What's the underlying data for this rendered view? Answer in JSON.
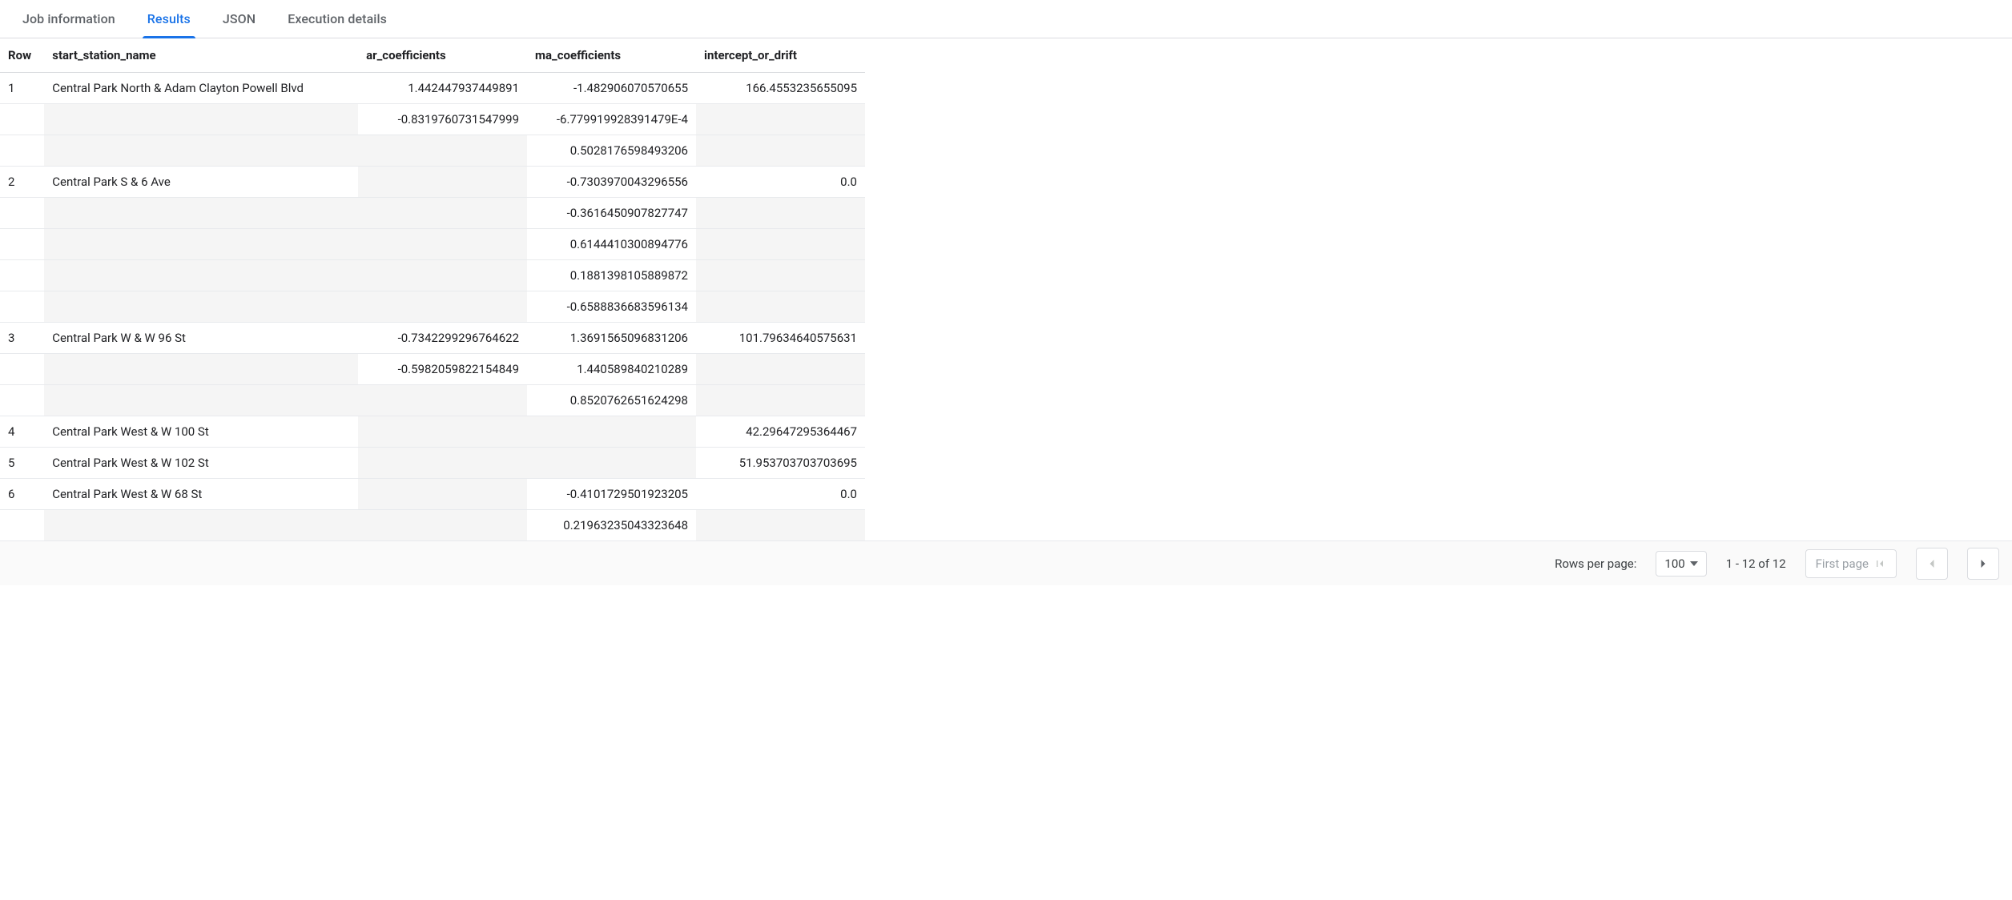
{
  "tabs": {
    "job_information": "Job information",
    "results": "Results",
    "json": "JSON",
    "execution_details": "Execution details"
  },
  "columns": {
    "row": "Row",
    "start_station_name": "start_station_name",
    "ar_coefficients": "ar_coefficients",
    "ma_coefficients": "ma_coefficients",
    "intercept_or_drift": "intercept_or_drift"
  },
  "rows": [
    {
      "row": "1",
      "name": "Central Park North & Adam Clayton Powell Blvd",
      "ar": [
        "1.442447937449891",
        "-0.8319760731547999",
        ""
      ],
      "ma": [
        "-1.482906070570655",
        "-6.779919928391479E-4",
        "0.5028176598493206"
      ],
      "intercept": "166.4553235655095"
    },
    {
      "row": "2",
      "name": "Central Park S & 6 Ave",
      "ar": [
        "",
        "",
        "",
        "",
        ""
      ],
      "ma": [
        "-0.7303970043296556",
        "-0.3616450907827747",
        "0.6144410300894776",
        "0.1881398105889872",
        "-0.6588836683596134"
      ],
      "intercept": "0.0"
    },
    {
      "row": "3",
      "name": "Central Park W & W 96 St",
      "ar": [
        "-0.7342299296764622",
        "-0.5982059822154849",
        ""
      ],
      "ma": [
        "1.3691565096831206",
        "1.440589840210289",
        "0.8520762651624298"
      ],
      "intercept": "101.79634640575631"
    },
    {
      "row": "4",
      "name": "Central Park West & W 100 St",
      "ar": [
        ""
      ],
      "ma": [
        ""
      ],
      "intercept": "42.29647295364467"
    },
    {
      "row": "5",
      "name": "Central Park West & W 102 St",
      "ar": [
        ""
      ],
      "ma": [
        ""
      ],
      "intercept": "51.953703703703695"
    },
    {
      "row": "6",
      "name": "Central Park West & W 68 St",
      "ar": [
        "",
        ""
      ],
      "ma": [
        "-0.4101729501923205",
        "0.21963235043323648"
      ],
      "intercept": "0.0"
    }
  ],
  "pagination": {
    "rows_per_page_label": "Rows per page:",
    "rows_per_page_value": "100",
    "range_text": "1 - 12 of 12",
    "first_page_label": "First page"
  }
}
